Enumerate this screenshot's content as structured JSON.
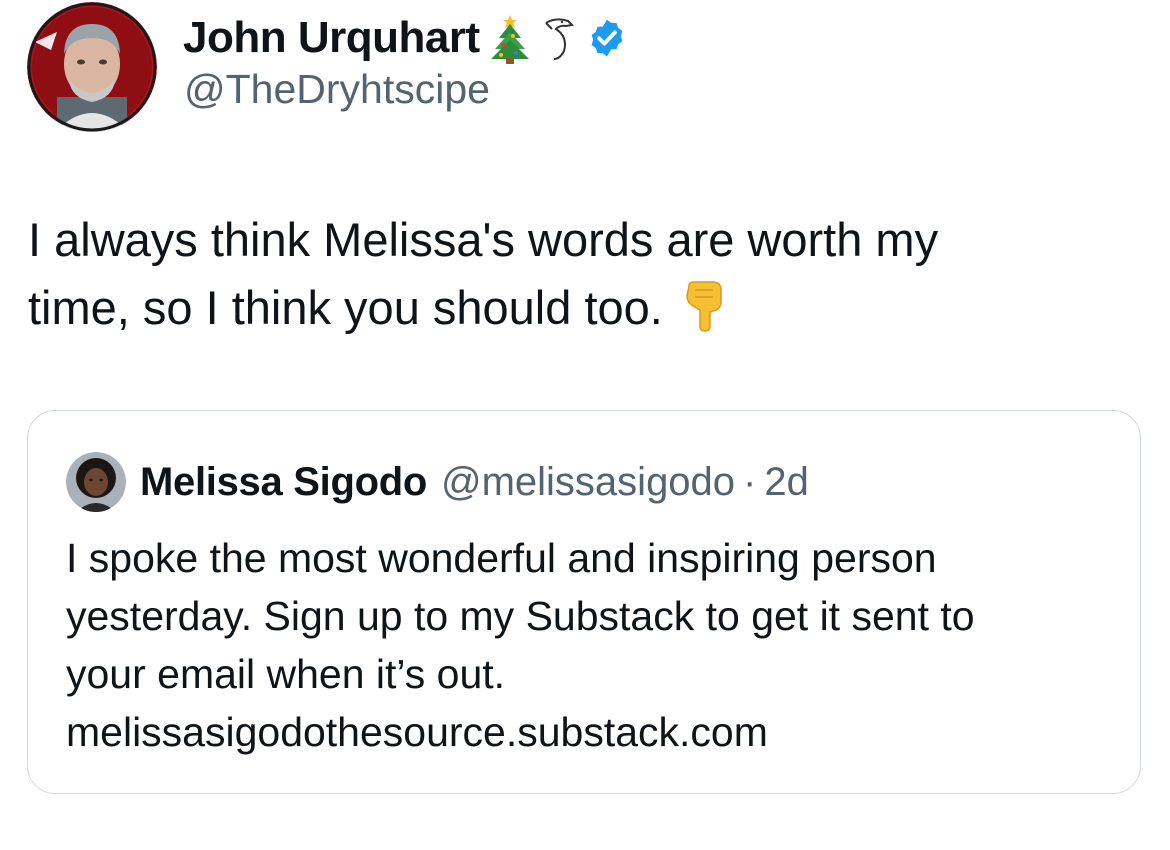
{
  "author": {
    "name": "John Urquhart",
    "handle": "@TheDryhtscipe",
    "name_icons": [
      "christmas-tree-icon",
      "swan-icon",
      "verified-badge-icon"
    ],
    "verified_color": "#1d9bf0"
  },
  "tweet": {
    "lines": [
      "I always think Melissa's words are worth my",
      "time, so I think you should too."
    ],
    "trailing_icon": "pointing-down-hand-icon"
  },
  "quoted_tweet": {
    "name": "Melissa Sigodo",
    "handle": "@melissasigodo",
    "separator": "·",
    "time": "2d",
    "lines": [
      "I spoke the most wonderful and inspiring person",
      "yesterday. Sign up to my Substack to get it sent to",
      "your email when it’s out.",
      "melissasigodothesource.substack.com"
    ]
  },
  "colors": {
    "text": "#0f1419",
    "secondary_text": "#536471",
    "card_border": "#cfd9de"
  }
}
